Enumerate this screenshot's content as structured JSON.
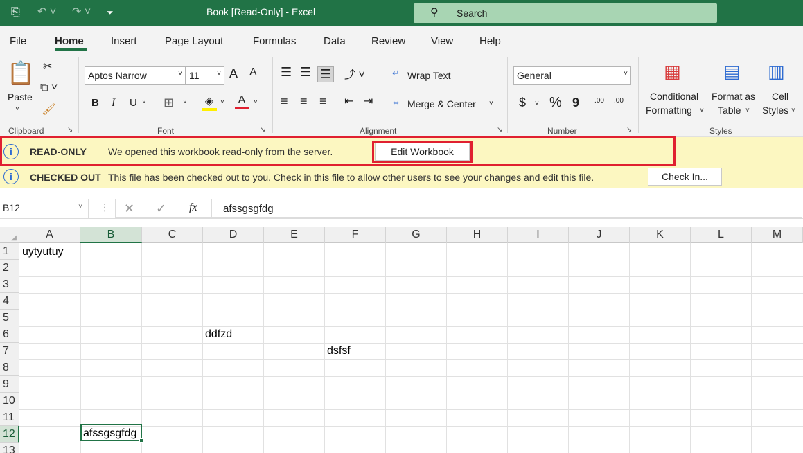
{
  "titlebar": {
    "title": "Book  [Read-Only]  -  Excel",
    "search_placeholder": "Search",
    "icons": [
      "autosave-icon",
      "undo-icon",
      "redo-icon",
      "customize-qat-icon",
      "search-icon"
    ],
    "color": "#217346"
  },
  "tabs": [
    "File",
    "Home",
    "Insert",
    "Page Layout",
    "Formulas",
    "Data",
    "Review",
    "View",
    "Help"
  ],
  "ribbon": {
    "clipboard": {
      "label": "Clipboard",
      "paste": "Paste"
    },
    "font": {
      "label": "Font",
      "name": "Aptos Narrow",
      "size": "11",
      "bold": "B",
      "italic": "I",
      "underline": "U",
      "grow": "A",
      "shrink": "A",
      "fontcolor": "A"
    },
    "alignment": {
      "label": "Alignment",
      "wrap": "Wrap Text",
      "merge": "Merge & Center"
    },
    "number": {
      "label": "Number",
      "format": "General",
      "currency": "$",
      "percent": "%",
      "comma": "9",
      "inc": ".00",
      "dec": ".00"
    },
    "styles": {
      "label": "Styles",
      "conditional1": "Conditional",
      "conditional2": "Formatting",
      "format1": "Format as",
      "format2": "Table",
      "cell1": "Cell",
      "cell2": "Styles"
    }
  },
  "messages": [
    {
      "title": "READ-ONLY",
      "text": "We opened this workbook read-only from the server.",
      "button": "Edit Workbook"
    },
    {
      "title": "CHECKED OUT",
      "text": "This file has been checked out to you. Check in this file to allow other users to see your changes and edit this file.",
      "button": "Check In..."
    }
  ],
  "formula": {
    "namebox": "B12",
    "value": "afssgsgfdg",
    "fx": "fx"
  },
  "columns": [
    "A",
    "B",
    "C",
    "D",
    "E",
    "F",
    "G",
    "H",
    "I",
    "J",
    "K",
    "L",
    "M"
  ],
  "rows": [
    "1",
    "2",
    "3",
    "4",
    "5",
    "6",
    "7",
    "8",
    "9",
    "10",
    "11",
    "12",
    "13"
  ],
  "cells": {
    "A1": "uytyutuy",
    "D6": "ddfzd",
    "F7": "dsfsf",
    "B12": "afssgsgfdg"
  },
  "selected_cell": "B12",
  "accent": "#217346",
  "highlight_color": "#e02030"
}
